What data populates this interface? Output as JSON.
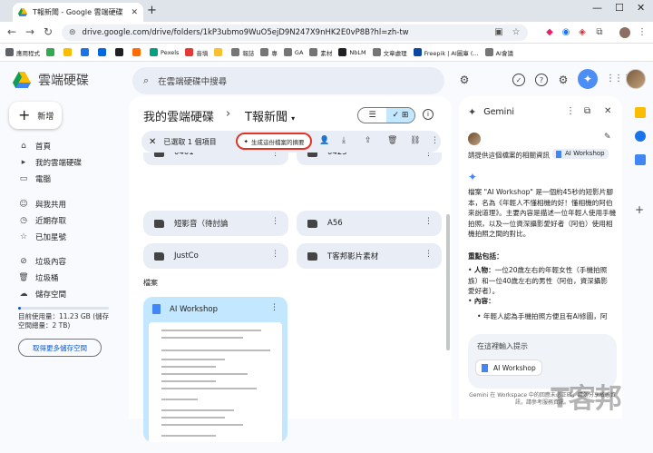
{
  "browser": {
    "tab_title": "T報新聞 - Google 雲端硬碟",
    "url": "drive.google.com/drive/folders/1kP3ubmo9WuO5ejD9N247X9nHK2E0vP8B?hl=zh-tw",
    "bookmarks": [
      {
        "label": "應用程式",
        "color": "#5f6368"
      },
      {
        "label": "",
        "color": "#34a853"
      },
      {
        "label": "",
        "color": "#fbbc04"
      },
      {
        "label": "",
        "color": "#1a73e8"
      },
      {
        "label": "",
        "color": "#0668e1"
      },
      {
        "label": "",
        "color": "#202124"
      },
      {
        "label": "",
        "color": "#ff6d00"
      },
      {
        "label": "Pexels",
        "color": "#05a081"
      },
      {
        "label": "音填",
        "color": "#e53935"
      },
      {
        "label": "",
        "color": "#fbc02d"
      },
      {
        "label": "報誌",
        "color": "#757575"
      },
      {
        "label": "專",
        "color": "#757575"
      },
      {
        "label": "GA",
        "color": "#757575"
      },
      {
        "label": "素材",
        "color": "#757575"
      },
      {
        "label": "NbLM",
        "color": "#202124"
      },
      {
        "label": "文章處理",
        "color": "#757575"
      },
      {
        "label": "Freepik | AI圖庫 (...",
        "color": "#0d47a1"
      },
      {
        "label": "AI會議",
        "color": "#757575"
      }
    ]
  },
  "app": {
    "name": "雲端硬碟",
    "search_placeholder": "在雲端硬碟中搜尋"
  },
  "sidebar": {
    "new_label": "新增",
    "items": [
      {
        "label": "首頁",
        "icon": "home-icon",
        "glyph": "⌂"
      },
      {
        "label": "我的雲端硬碟",
        "icon": "drive-icon",
        "glyph": "▸"
      },
      {
        "label": "電腦",
        "icon": "computer-icon",
        "glyph": "▭"
      },
      {
        "label": "與我共用",
        "icon": "shared-icon",
        "glyph": "☺"
      },
      {
        "label": "近期存取",
        "icon": "clock-icon",
        "glyph": "◷"
      },
      {
        "label": "已加星號",
        "icon": "star-icon",
        "glyph": "☆"
      },
      {
        "label": "垃圾內容",
        "icon": "spam-icon",
        "glyph": "⊘"
      },
      {
        "label": "垃圾桶",
        "icon": "trash-icon",
        "glyph": "🗑"
      },
      {
        "label": "儲存空間",
        "icon": "cloud-icon",
        "glyph": "☁"
      }
    ],
    "storage_text": "目前使用量：11.23 GB (儲存空間總量：2 TB)",
    "storage_used_fraction": 0.005,
    "buy_more_label": "取得更多儲存空間"
  },
  "main": {
    "breadcrumb_root": "我的雲端硬碟",
    "breadcrumb_current": "T報新聞",
    "selection_text": "已選取 1 個項目",
    "summarize_label": "生成這份檔案的摘要",
    "folders": [
      {
        "name": "0401"
      },
      {
        "name": "0425"
      },
      {
        "name": "短影音（待討論"
      },
      {
        "name": "A56"
      },
      {
        "name": "JustCo"
      },
      {
        "name": "T客邦影片素材"
      }
    ],
    "files_label": "檔案",
    "file_card": {
      "name": "AI Workshop"
    }
  },
  "gemini": {
    "title": "Gemini",
    "prompt": "請提供這個檔案的相關資訊",
    "chip_label": "AI Workshop",
    "response": "檔案 \"AI Workshop\" 是一個約45秒的短影片腳本，名為《年輕人不懂相機的好！懂相機的阿伯來說道理》。主要內容是描述一位年輕人使用手機拍照，以及一位資深攝影愛好者（阿伯）使用相機拍照之間的對比。",
    "highlights_title": "重點包括：",
    "bullet_1_label": "人物：",
    "bullet_1_text": "一位20歲左右的年輕女性（手機拍照族）和一位40歲左右的男性（阿伯，資深攝影愛好者）。",
    "bullet_2_label": "內容：",
    "sub_bullet": "年輕人認為手機拍照方便且有AI修圖，阿",
    "input_placeholder": "在這裡輸入提示",
    "input_chip": "AI Workshop",
    "footer": "Gemini 在 Workspace 中的回應未必正確，請勿分享敏感資訊，請參考服務資訊。"
  },
  "watermark": "T客邦"
}
